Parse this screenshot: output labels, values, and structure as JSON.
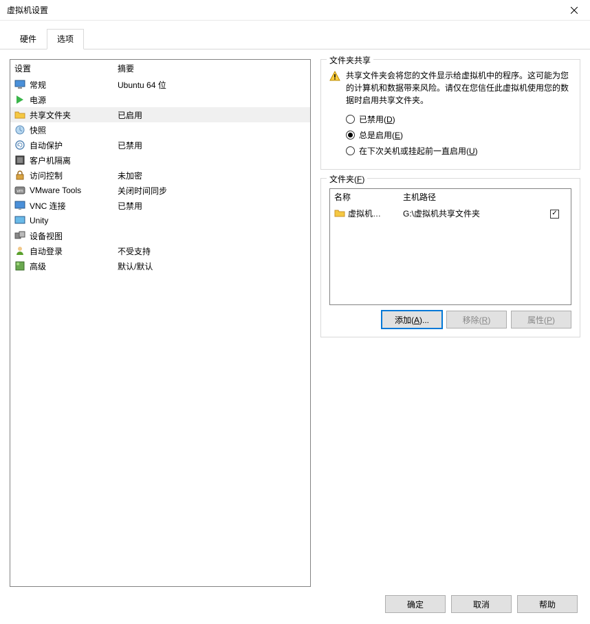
{
  "window": {
    "title": "虚拟机设置"
  },
  "tabs": {
    "hardware": "硬件",
    "options": "选项"
  },
  "list": {
    "header_settings": "设置",
    "header_summary": "摘要",
    "items": [
      {
        "name": "常规",
        "summary": "Ubuntu 64 位"
      },
      {
        "name": "电源",
        "summary": ""
      },
      {
        "name": "共享文件夹",
        "summary": "已启用"
      },
      {
        "name": "快照",
        "summary": ""
      },
      {
        "name": "自动保护",
        "summary": "已禁用"
      },
      {
        "name": "客户机隔离",
        "summary": ""
      },
      {
        "name": "访问控制",
        "summary": "未加密"
      },
      {
        "name": "VMware Tools",
        "summary": "关闭时间同步"
      },
      {
        "name": "VNC 连接",
        "summary": "已禁用"
      },
      {
        "name": "Unity",
        "summary": ""
      },
      {
        "name": "设备视图",
        "summary": ""
      },
      {
        "name": "自动登录",
        "summary": "不受支持"
      },
      {
        "name": "高级",
        "summary": "默认/默认"
      }
    ]
  },
  "sharing": {
    "group_title": "文件夹共享",
    "warning": "共享文件夹会将您的文件显示给虚拟机中的程序。这可能为您的计算机和数据带来风险。请仅在您信任此虚拟机使用您的数据时启用共享文件夹。",
    "radios": {
      "disabled_pre": "已禁用(",
      "disabled_key": "D",
      "disabled_post": ")",
      "always_pre": "总是启用(",
      "always_key": "E",
      "always_post": ")",
      "until_pre": "在下次关机或挂起前一直启用(",
      "until_key": "U",
      "until_post": ")"
    }
  },
  "folders": {
    "group_title_pre": "文件夹(",
    "group_title_key": "F",
    "group_title_post": ")",
    "col_name": "名称",
    "col_path": "主机路径",
    "rows": [
      {
        "name": "虚拟机…",
        "path": "G:\\虚拟机共享文件夹",
        "checked": true
      }
    ],
    "buttons": {
      "add_pre": "添加(",
      "add_key": "A",
      "add_post": ")...",
      "remove_pre": "移除(",
      "remove_key": "R",
      "remove_post": ")",
      "props_pre": "属性(",
      "props_key": "P",
      "props_post": ")"
    }
  },
  "bottom": {
    "ok": "确定",
    "cancel": "取消",
    "help": "帮助"
  }
}
